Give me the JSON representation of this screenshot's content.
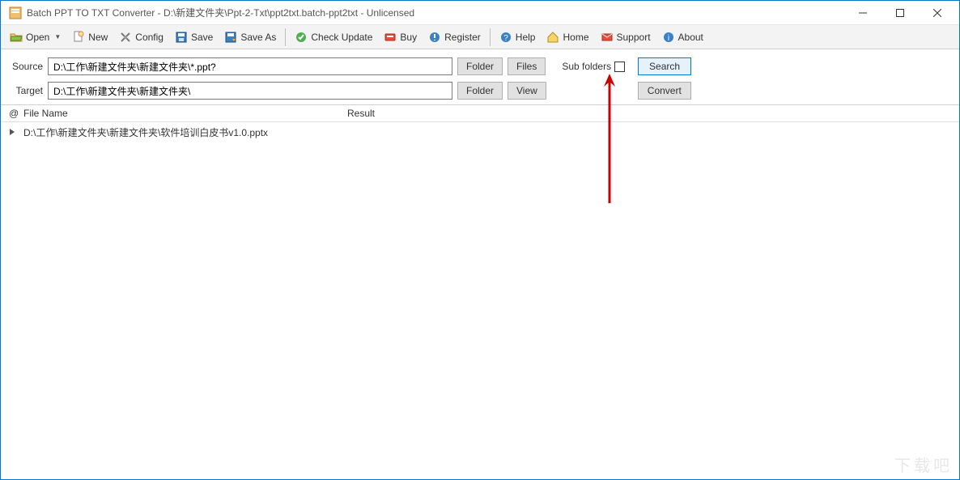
{
  "window": {
    "title": "Batch PPT TO TXT Converter - D:\\新建文件夹\\Ppt-2-Txt\\ppt2txt.batch-ppt2txt - Unlicensed"
  },
  "toolbar": {
    "open": "Open",
    "new": "New",
    "config": "Config",
    "save": "Save",
    "save_as": "Save As",
    "check_update": "Check Update",
    "buy": "Buy",
    "register": "Register",
    "help": "Help",
    "home": "Home",
    "support": "Support",
    "about": "About"
  },
  "form": {
    "source_label": "Source",
    "source_value": "D:\\工作\\新建文件夹\\新建文件夹\\*.ppt?",
    "target_label": "Target",
    "target_value": "D:\\工作\\新建文件夹\\新建文件夹\\",
    "folder_btn": "Folder",
    "files_btn": "Files",
    "view_btn": "View",
    "subfolders_label": "Sub folders",
    "search_btn": "Search",
    "convert_btn": "Convert"
  },
  "list": {
    "header_at": "@",
    "header_file": "File Name",
    "header_result": "Result",
    "rows": [
      {
        "file": "D:\\工作\\新建文件夹\\新建文件夹\\软件培训白皮书v1.0.pptx",
        "result": ""
      }
    ]
  },
  "watermark": "下载吧",
  "colors": {
    "accent": "#0078d7"
  }
}
